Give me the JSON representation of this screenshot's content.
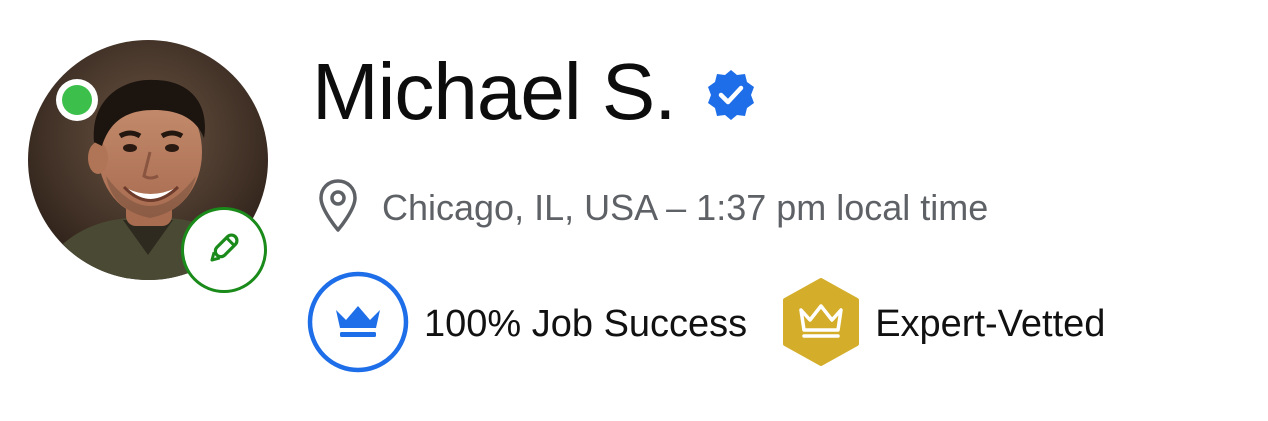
{
  "profile": {
    "name": "Michael S.",
    "location": "Chicago, IL, USA – 1:37 pm local time",
    "verified": true,
    "online": true
  },
  "badges": [
    {
      "label": "100% Job Success",
      "icon": "crown-icon",
      "color": "#1d6ee8"
    },
    {
      "label": "Expert-Vetted",
      "icon": "crown-icon",
      "color": "#d4ae2b"
    }
  ],
  "colors": {
    "online": "#3dbf4b",
    "edit": "#1a8a1a",
    "verified": "#1d6ee8",
    "job_success": "#1d6ee8",
    "expert_vetted": "#d4ae2b",
    "secondary_text": "#5e6166"
  }
}
